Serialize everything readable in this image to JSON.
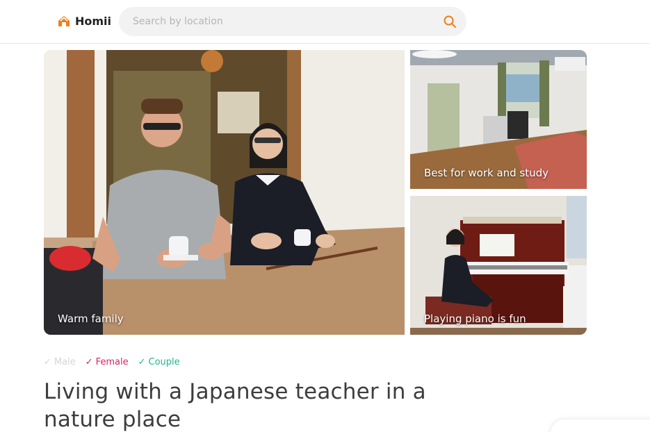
{
  "brand": {
    "name": "Homii",
    "accent_color": "#f07f1a"
  },
  "search": {
    "placeholder": "Search by location",
    "value": ""
  },
  "gallery": {
    "photos": [
      {
        "caption": "Warm family"
      },
      {
        "caption": "Best for work and study"
      },
      {
        "caption": "Playing piano is fun"
      }
    ]
  },
  "listing": {
    "tags": [
      {
        "label": "Male",
        "active": false,
        "color": "#d5d5d5"
      },
      {
        "label": "Female",
        "active": true,
        "color": "#d6245e"
      },
      {
        "label": "Couple",
        "active": true,
        "color": "#21b58a"
      }
    ],
    "title": "Living with a Japanese teacher in a nature place"
  }
}
